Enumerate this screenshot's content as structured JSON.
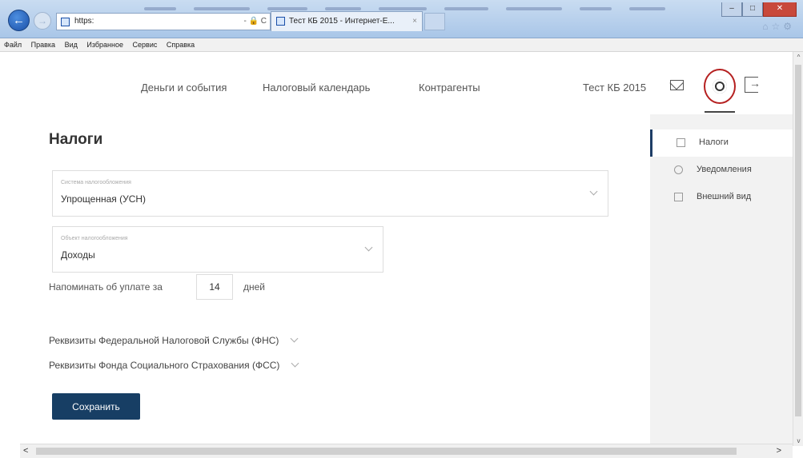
{
  "browser": {
    "address": "https:",
    "tab_title": "Тест КБ 2015 - Интернет-Е...",
    "tab_close": "×",
    "menu": [
      "Файл",
      "Правка",
      "Вид",
      "Избранное",
      "Сервис",
      "Справка"
    ],
    "addr_tools": "- 🔒 C"
  },
  "nav": {
    "links": [
      "Деньги и события",
      "Налоговый календарь",
      "Контрагенты"
    ],
    "company": "Тест КБ 2015"
  },
  "page": {
    "title": "Налоги",
    "tax_system": {
      "label": "Система налогообложения",
      "value": "Упрощенная (УСН)"
    },
    "tax_object": {
      "label": "Объект налогообложения",
      "value": "Доходы"
    },
    "remind_label": "Напоминать об уплате за",
    "remind_days": "14",
    "remind_unit": "дней",
    "fns_details": "Реквизиты Федеральной Налоговой Службы (ФНС)",
    "fss_details": "Реквизиты Фонда Социального Страхования (ФСС)",
    "save_label": "Сохранить"
  },
  "sidebar": {
    "items": [
      {
        "label": "Налоги",
        "icon": "document-icon",
        "active": true
      },
      {
        "label": "Уведомления",
        "icon": "bell-icon",
        "active": false
      },
      {
        "label": "Внешний вид",
        "icon": "layout-icon",
        "active": false
      }
    ]
  },
  "colors": {
    "accent": "#173e64",
    "highlight_circle": "#b52020",
    "sidebar_bg": "#f2f2f2"
  }
}
